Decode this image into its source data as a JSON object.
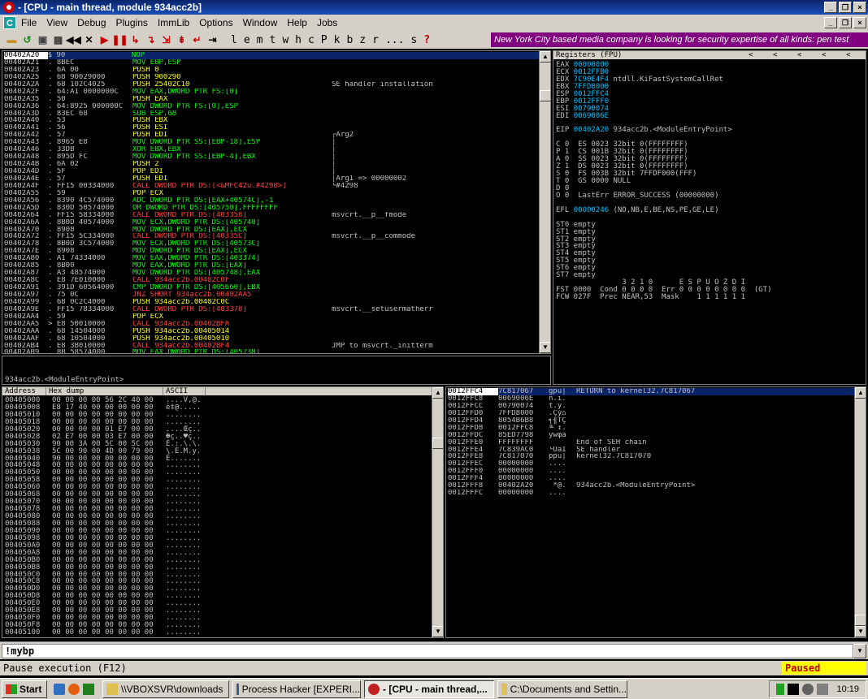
{
  "window": {
    "title": "- [CPU - main thread, module 934acc2b]",
    "min_glyph": "_",
    "restore_glyph": "❐",
    "close_glyph": "×"
  },
  "menu": {
    "icon_label": "C",
    "items": [
      "File",
      "View",
      "Debug",
      "Plugins",
      "ImmLib",
      "Options",
      "Window",
      "Help",
      "Jobs"
    ]
  },
  "toolbar": {
    "icons": [
      "open-folder-icon",
      "rewind-icon",
      "close-process-icon",
      "run-icon",
      "pause-icon",
      "step-into-icon",
      "step-over-icon",
      "trace-into-icon",
      "trace-over-icon",
      "execute-till-return-icon",
      "go-to-icon"
    ],
    "letters": [
      "l",
      "e",
      "m",
      "t",
      "w",
      "h",
      "c",
      "P",
      "k",
      "b",
      "z",
      "r",
      "...",
      "s",
      "?"
    ],
    "ad_text": "New York City based media company is looking for security expertise of all kinds: pen test"
  },
  "disasm": {
    "rows": [
      {
        "addr": "00402A20",
        "hex": "$ 90",
        "asm": "NOP",
        "asm_color": "#00ff00",
        "com": ""
      },
      {
        "addr": "00402A21",
        "hex": ". 8BEC",
        "asm": "MOV EBP,ESP",
        "asm_color": "#00ff00",
        "com": ""
      },
      {
        "addr": "00402A23",
        "hex": ". 6A 00",
        "asm": "PUSH 0",
        "asm_color": "#ffff00",
        "com": ""
      },
      {
        "addr": "00402A25",
        "hex": ". 68 90029000",
        "asm": "PUSH 900290",
        "asm_color": "#ffff00",
        "com": ""
      },
      {
        "addr": "00402A2A",
        "hex": ". 68 102C4025",
        "asm": "PUSH 25402C10",
        "asm_color": "#ffff00",
        "com": "SE handler installation"
      },
      {
        "addr": "00402A2F",
        "hex": ". 64:A1 0000000C",
        "asm": "MOV EAX,DWORD PTR FS:[0]",
        "asm_color": "#00ff00",
        "com": ""
      },
      {
        "addr": "00402A35",
        "hex": ". 50",
        "asm": "PUSH EAX",
        "asm_color": "#ffff00",
        "com": ""
      },
      {
        "addr": "00402A36",
        "hex": ". 64:8925 000000C",
        "asm": "MOV DWORD PTR FS:[0],ESP",
        "asm_color": "#00ff00",
        "com": ""
      },
      {
        "addr": "00402A3D",
        "hex": ". 83EC 68",
        "asm": "SUB ESP,68",
        "asm_color": "#00ff00",
        "com": ""
      },
      {
        "addr": "00402A40",
        "hex": ". 53",
        "asm": "PUSH EBX",
        "asm_color": "#ffff00",
        "com": ""
      },
      {
        "addr": "00402A41",
        "hex": ". 56",
        "asm": "PUSH ESI",
        "asm_color": "#ffff00",
        "com": ""
      },
      {
        "addr": "00402A42",
        "hex": ". 57",
        "asm": "PUSH EDI",
        "asm_color": "#ffff00",
        "com": "┌Arg2"
      },
      {
        "addr": "00402A43",
        "hex": ". 8965 E8",
        "asm": "MOV DWORD PTR SS:[EBP-18],ESP",
        "asm_color": "#00ff00",
        "com": "│"
      },
      {
        "addr": "00402A46",
        "hex": ". 33DB",
        "asm": "XOR EBX,EBX",
        "asm_color": "#00ff00",
        "com": "│"
      },
      {
        "addr": "00402A48",
        "hex": ". 895D FC",
        "asm": "MOV DWORD PTR SS:[EBP-4],EBX",
        "asm_color": "#00ff00",
        "com": "│"
      },
      {
        "addr": "00402A4B",
        "hex": ". 6A 02",
        "asm": "PUSH 2",
        "asm_color": "#ffff00",
        "com": "│"
      },
      {
        "addr": "00402A4D",
        "hex": ". 5F",
        "asm": "POP EDI",
        "asm_color": "#ffff00",
        "com": "│"
      },
      {
        "addr": "00402A4E",
        "hex": ". 57",
        "asm": "PUSH EDI",
        "asm_color": "#ffff00",
        "com": "│Arg1 => 00000002"
      },
      {
        "addr": "00402A4F",
        "hex": ". FF15 00334000",
        "asm": "CALL DWORD PTR DS:[<&MFC42u.#4298>]",
        "asm_color": "#ff4040",
        "com": "└#4298"
      },
      {
        "addr": "00402A55",
        "hex": ". 59",
        "asm": "POP ECX",
        "asm_color": "#ffff00",
        "com": ""
      },
      {
        "addr": "00402A56",
        "hex": ". 8390 4C574000",
        "asm": "ADC DWORD PTR DS:[EAX+40574C],-1",
        "asm_color": "#00ff00",
        "com": ""
      },
      {
        "addr": "00402A5D",
        "hex": ". 830D 50574000",
        "asm": "OR DWORD PTR DS:[405750],FFFFFFFF",
        "asm_color": "#00ff00",
        "com": ""
      },
      {
        "addr": "00402A64",
        "hex": ". FF15 58334000",
        "asm": "CALL DWORD PTR DS:[403358]",
        "asm_color": "#ff4040",
        "com": "msvcrt.__p__fmode"
      },
      {
        "addr": "00402A6A",
        "hex": ". 8B0D 40574000",
        "asm": "MOV ECX,DWORD PTR DS:[405740]",
        "asm_color": "#00ff00",
        "com": ""
      },
      {
        "addr": "00402A70",
        "hex": ". 8908",
        "asm": "MOV DWORD PTR DS:[EAX],ECX",
        "asm_color": "#00ff00",
        "com": ""
      },
      {
        "addr": "00402A72",
        "hex": ". FF15 5C334000",
        "asm": "CALL DWORD PTR DS:[40335C]",
        "asm_color": "#ff4040",
        "com": "msvcrt.__p__commode"
      },
      {
        "addr": "00402A78",
        "hex": ". 8B0D 3C574000",
        "asm": "MOV ECX,DWORD PTR DS:[40573C]",
        "asm_color": "#00ff00",
        "com": ""
      },
      {
        "addr": "00402A7E",
        "hex": ". 8908",
        "asm": "MOV DWORD PTR DS:[EAX],ECX",
        "asm_color": "#00ff00",
        "com": ""
      },
      {
        "addr": "00402A80",
        "hex": ". A1 74334000",
        "asm": "MOV EAX,DWORD PTR DS:[403374]",
        "asm_color": "#00ff00",
        "com": ""
      },
      {
        "addr": "00402A85",
        "hex": ". 8B00",
        "asm": "MOV EAX,DWORD PTR DS:[EAX]",
        "asm_color": "#00ff00",
        "com": ""
      },
      {
        "addr": "00402A87",
        "hex": ". A3 48574000",
        "asm": "MOV DWORD PTR DS:[405748],EAX",
        "asm_color": "#00ff00",
        "com": ""
      },
      {
        "addr": "00402A8C",
        "hex": ". E8 7E010000",
        "asm": "CALL 934acc2b.00402C0F",
        "asm_color": "#ff4040",
        "com": ""
      },
      {
        "addr": "00402A91",
        "hex": ". 391D 60564000",
        "asm": "CMP DWORD PTR DS:[405660],EBX",
        "asm_color": "#00ff00",
        "com": ""
      },
      {
        "addr": "00402A97",
        "hex": ". 75 0C",
        "asm": "JNZ SHORT 934acc2b.00402AA5",
        "asm_color": "#ff4040",
        "com": ""
      },
      {
        "addr": "00402A99",
        "hex": ". 68 0C2C4000",
        "asm": "PUSH 934acc2b.00402C0C",
        "asm_color": "#ffff00",
        "com": ""
      },
      {
        "addr": "00402A9E",
        "hex": ". FF15 78334000",
        "asm": "CALL DWORD PTR DS:[403378]",
        "asm_color": "#ff4040",
        "com": "msvcrt.__setusermatherr"
      },
      {
        "addr": "00402AA4",
        "hex": ". 59",
        "asm": "POP ECX",
        "asm_color": "#ffff00",
        "com": ""
      },
      {
        "addr": "00402AA5",
        "hex": "> E8 50010000",
        "asm": "CALL 934acc2b.00402BFA",
        "asm_color": "#ff4040",
        "com": ""
      },
      {
        "addr": "00402AAA",
        "hex": ". 68 14504000",
        "asm": "PUSH 934acc2b.00405014",
        "asm_color": "#ffff00",
        "com": ""
      },
      {
        "addr": "00402AAF",
        "hex": ". 68 10504000",
        "asm": "PUSH 934acc2b.00405010",
        "asm_color": "#ffff00",
        "com": ""
      },
      {
        "addr": "00402AB4",
        "hex": ". E8 3B010000",
        "asm": "CALL 934acc2b.00402BF4",
        "asm_color": "#ff4040",
        "com": "JMP to msvcrt._initterm"
      },
      {
        "addr": "00402AB9",
        "hex": ". 8B 58574000",
        "asm": "MOV EAX,DWORD PTR DS:[405738]",
        "asm_color": "#00ff00",
        "com": ""
      }
    ]
  },
  "info_line": "934acc2b.<ModuleEntryPoint>",
  "registers": {
    "header": "Registers (FPU)",
    "header_arrows": [
      "<",
      "<",
      "<",
      "<",
      "<"
    ],
    "lines": [
      {
        "t": "EAX ",
        "v": "00000000",
        "r": ""
      },
      {
        "t": "ECX ",
        "v": "0012FFB0",
        "r": ""
      },
      {
        "t": "EDX ",
        "v": "7C90E4F4",
        "r": " ntdll.KiFastSystemCallRet"
      },
      {
        "t": "EBX ",
        "v": "7FFD8000",
        "r": ""
      },
      {
        "t": "ESP ",
        "v": "0012FFC4",
        "r": ""
      },
      {
        "t": "EBP ",
        "v": "0012FFF0",
        "r": ""
      },
      {
        "t": "ESI ",
        "v": "00790074",
        "r": ""
      },
      {
        "t": "EDI ",
        "v": "0069006E",
        "r": ""
      },
      {
        "t": "",
        "v": "",
        "r": ""
      },
      {
        "t": "EIP ",
        "v": "00402A20",
        "r": " 934acc2b.<ModuleEntryPoint>"
      },
      {
        "t": "",
        "v": "",
        "r": ""
      },
      {
        "t": "C 0  ES 0023 32bit 0(FFFFFFFF)",
        "v": "",
        "r": ""
      },
      {
        "t": "P 1  CS 001B 32bit 0(FFFFFFFF)",
        "v": "",
        "r": ""
      },
      {
        "t": "A 0  SS 0023 32bit 0(FFFFFFFF)",
        "v": "",
        "r": ""
      },
      {
        "t": "Z 1  DS 0023 32bit 0(FFFFFFFF)",
        "v": "",
        "r": ""
      },
      {
        "t": "S 0  FS 003B 32bit 7FFDF000(FFF)",
        "v": "",
        "r": ""
      },
      {
        "t": "T 0  GS 0000 NULL",
        "v": "",
        "r": ""
      },
      {
        "t": "D 0",
        "v": "",
        "r": ""
      },
      {
        "t": "O 0  LastErr ERROR_SUCCESS (00000000)",
        "v": "",
        "r": ""
      },
      {
        "t": "",
        "v": "",
        "r": ""
      },
      {
        "t": "EFL ",
        "v": "00000246",
        "r": " (NO,NB,E,BE,NS,PE,GE,LE)"
      },
      {
        "t": "",
        "v": "",
        "r": ""
      },
      {
        "t": "ST0 empty",
        "v": "",
        "r": ""
      },
      {
        "t": "ST1 empty",
        "v": "",
        "r": ""
      },
      {
        "t": "ST2 empty",
        "v": "",
        "r": ""
      },
      {
        "t": "ST3 empty",
        "v": "",
        "r": ""
      },
      {
        "t": "ST4 empty",
        "v": "",
        "r": ""
      },
      {
        "t": "ST5 empty",
        "v": "",
        "r": ""
      },
      {
        "t": "ST6 empty",
        "v": "",
        "r": ""
      },
      {
        "t": "ST7 empty",
        "v": "",
        "r": ""
      },
      {
        "t": "               3 2 1 0      E S P U O Z D I",
        "v": "",
        "r": ""
      },
      {
        "t": "FST 0000  Cond 0 0 0 0  Err 0 0 0 0 0 0 0 0  (GT)",
        "v": "",
        "r": ""
      },
      {
        "t": "FCW 027F  Prec NEAR,53  Mask    1 1 1 1 1 1",
        "v": "",
        "r": ""
      }
    ]
  },
  "dump": {
    "headers": [
      "Address",
      "Hex dump",
      "ASCII"
    ],
    "rows": [
      [
        "00405000",
        "00 00 00 00 56 2C 40 00",
        "....V,@."
      ],
      [
        "00405008",
        "E8 17 40 00 00 00 00 00",
        "è‡@....."
      ],
      [
        "00405010",
        "00 00 00 00 00 00 00 00",
        "........"
      ],
      [
        "00405018",
        "00 00 00 00 00 00 00 00",
        "........"
      ],
      [
        "00405020",
        "00 00 00 00 01 E7 00 00",
        "....Œç.."
      ],
      [
        "00405028",
        "02 E7 00 00 03 E7 00 00",
        "☻ç..♥ç.."
      ],
      [
        "00405030",
        "90 00 3A 00 5C 00 5C 00",
        "É.:.\\.\\."
      ],
      [
        "00405038",
        "5C 00 90 00 4D 00 79 00",
        "\\.É.M.y."
      ],
      [
        "00405040",
        "90 00 00 00 00 00 00 00",
        "É......."
      ],
      [
        "00405048",
        "00 00 00 00 00 00 00 00",
        "........"
      ],
      [
        "00405050",
        "00 00 00 00 00 00 00 00",
        "........"
      ],
      [
        "00405058",
        "00 00 00 00 00 00 00 00",
        "........"
      ],
      [
        "00405060",
        "00 00 00 00 00 00 00 00",
        "........"
      ],
      [
        "00405068",
        "00 00 00 00 00 00 00 00",
        "........"
      ],
      [
        "00405070",
        "00 00 00 00 00 00 00 00",
        "........"
      ],
      [
        "00405078",
        "00 00 00 00 00 00 00 00",
        "........"
      ],
      [
        "00405080",
        "00 00 00 00 00 00 00 00",
        "........"
      ],
      [
        "00405088",
        "00 00 00 00 00 00 00 00",
        "........"
      ],
      [
        "00405090",
        "00 00 00 00 00 00 00 00",
        "........"
      ],
      [
        "00405098",
        "00 00 00 00 00 00 00 00",
        "........"
      ],
      [
        "004050A0",
        "00 00 00 00 00 00 00 00",
        "........"
      ],
      [
        "004050A8",
        "00 00 00 00 00 00 00 00",
        "........"
      ],
      [
        "004050B0",
        "00 00 00 00 00 00 00 00",
        "........"
      ],
      [
        "004050B8",
        "00 00 00 00 00 00 00 00",
        "........"
      ],
      [
        "004050C0",
        "00 00 00 00 00 00 00 00",
        "........"
      ],
      [
        "004050C8",
        "00 00 00 00 00 00 00 00",
        "........"
      ],
      [
        "004050D0",
        "00 00 00 00 00 00 00 00",
        "........"
      ],
      [
        "004050D8",
        "00 00 00 00 00 00 00 00",
        "........"
      ],
      [
        "004050E0",
        "00 00 00 00 00 00 00 00",
        "........"
      ],
      [
        "004050E8",
        "00 00 00 00 00 00 00 00",
        "........"
      ],
      [
        "004050F0",
        "00 00 00 00 00 00 00 00",
        "........"
      ],
      [
        "004050F8",
        "00 00 00 00 00 00 00 00",
        "........"
      ],
      [
        "00405100",
        "00 00 00 00 00 00 00 00",
        "........"
      ]
    ]
  },
  "stack": {
    "rows": [
      {
        "addr": "0012FFC4",
        "val": "7C817067",
        "asc": "gpü|",
        "com": "RETURN to kernel32.7C817067",
        "sel": true
      },
      {
        "addr": "0012FFC8",
        "val": "0069006E",
        "asc": "n.i.",
        "com": ""
      },
      {
        "addr": "0012FFCC",
        "val": "00790074",
        "asc": "t.y.",
        "com": ""
      },
      {
        "addr": "0012FFD0",
        "val": "7FFD8000",
        "asc": ".Çý⌂",
        "com": ""
      },
      {
        "addr": "0012FFD4",
        "val": "8054B6B8",
        "asc": "╕╢TÇ",
        "com": ""
      },
      {
        "addr": "0012FFD8",
        "val": "0012FFC8",
        "asc": "╚ ↕.",
        "com": ""
      },
      {
        "addr": "0012FFDC",
        "val": "85ED7798",
        "asc": "ÿwφà",
        "com": ""
      },
      {
        "addr": "0012FFE0",
        "val": "FFFFFFFF",
        "asc": "    ",
        "com": "End of SEH chain"
      },
      {
        "addr": "0012FFE4",
        "val": "7C839AC0",
        "asc": "└ÜâΙ",
        "com": "SE handler"
      },
      {
        "addr": "0012FFE8",
        "val": "7C817070",
        "asc": "ppü|",
        "com": "kernel32.7C817070"
      },
      {
        "addr": "0012FFEC",
        "val": "00000000",
        "asc": "....",
        "com": ""
      },
      {
        "addr": "0012FFF0",
        "val": "00000000",
        "asc": "....",
        "com": ""
      },
      {
        "addr": "0012FFF4",
        "val": "00000000",
        "asc": "....",
        "com": ""
      },
      {
        "addr": "0012FFF8",
        "val": "00402A20",
        "asc": " *@.",
        "com": "934acc2b.<ModuleEntryPoint>"
      },
      {
        "addr": "0012FFFC",
        "val": "00000000",
        "asc": "....",
        "com": ""
      }
    ]
  },
  "command": {
    "value": "!mybp",
    "dropdown": "▼"
  },
  "status": {
    "text": "Pause execution (F12)",
    "state": "Paused"
  },
  "taskbar": {
    "start": "Start",
    "items": [
      "\\\\VBOXSVR\\downloads",
      "Process Hacker [EXPERI...",
      "- [CPU - main thread,...",
      "C:\\Documents and Settin..."
    ],
    "active_index": 2,
    "clock": "10:19"
  },
  "colors": {
    "addr": "#c0c0c0",
    "reg_val": "#00c0ff",
    "sel_bg": "#0a246a"
  }
}
